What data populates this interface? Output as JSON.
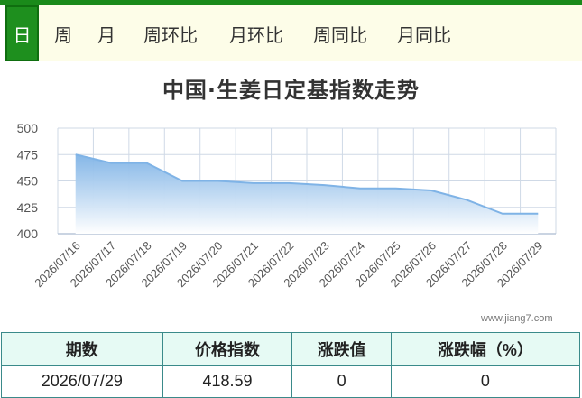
{
  "tabs": [
    "日",
    "周",
    "月",
    "周环比",
    "月环比",
    "周同比",
    "月同比"
  ],
  "active_tab": "日",
  "watermark": "www.jiang7.com",
  "chart_data": {
    "type": "area",
    "title": "中国·生姜日定基指数走势",
    "xlabel": "",
    "ylabel": "",
    "x": [
      "2026/07/16",
      "2026/07/17",
      "2026/07/18",
      "2026/07/19",
      "2026/07/20",
      "2026/07/21",
      "2026/07/22",
      "2026/07/23",
      "2026/07/24",
      "2026/07/25",
      "2026/07/26",
      "2026/07/27",
      "2026/07/28",
      "2026/07/29"
    ],
    "series": [
      {
        "values": [
          475,
          467,
          467,
          450,
          450,
          448,
          448,
          446,
          443,
          443,
          441,
          432,
          419,
          419
        ]
      }
    ],
    "ylim": [
      400,
      500
    ],
    "yticks": [
      400,
      425,
      450,
      475,
      500
    ],
    "grid": true,
    "colors": {
      "line": "#7fb3e6",
      "fill_top": "#7fb3e6",
      "fill_bottom": "#ffffff",
      "grid": "#cfd9e6",
      "axis_text": "#555555"
    }
  },
  "table": {
    "headers": [
      "期数",
      "价格指数",
      "涨跌值",
      "涨跌幅（%）"
    ],
    "row": [
      "2026/07/29",
      "418.59",
      "0",
      "0"
    ]
  }
}
